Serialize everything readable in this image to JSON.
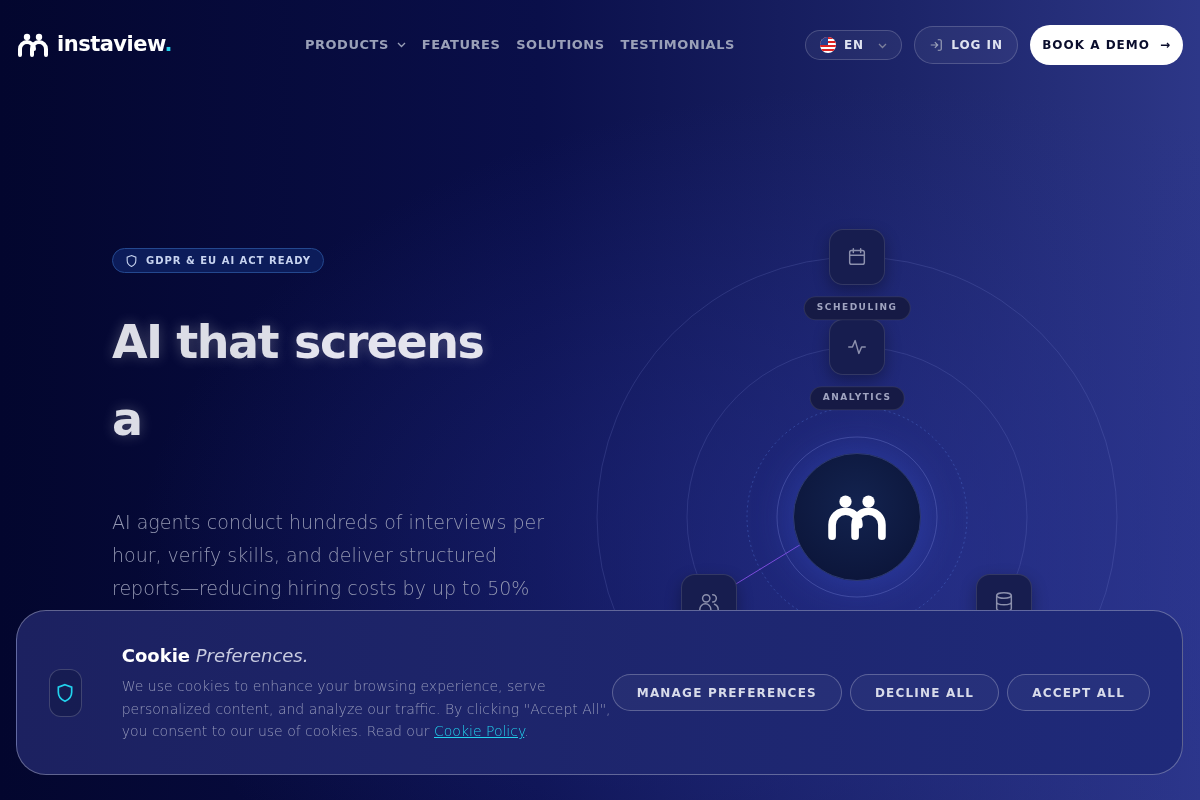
{
  "brand": {
    "name": "instaview",
    "dot": "."
  },
  "nav": [
    {
      "label": "PRODUCTS",
      "has_menu": true
    },
    {
      "label": "FEATURES",
      "has_menu": false
    },
    {
      "label": "SOLUTIONS",
      "has_menu": false
    },
    {
      "label": "TESTIMONIALS",
      "has_menu": false
    }
  ],
  "language": {
    "code": "EN"
  },
  "login": {
    "label": "LOG IN"
  },
  "demo": {
    "label": "BOOK A DEMO",
    "arrow": "→"
  },
  "hero": {
    "badge": "GDPR & EU AI ACT READY",
    "heading_static": "AI that",
    "heading_word": "screens",
    "heading_line_2": "a",
    "text": "AI agents conduct hundreds of interviews per hour, verify skills, and deliver structured reports—reducing hiring costs by up to 50%"
  },
  "diagram": {
    "labels": [
      "SCHEDULING",
      "ANALYTICS"
    ]
  },
  "cookie": {
    "title": "**Cookie** *Preferences.*",
    "text": "We use cookies to enhance your browsing experience, serve personalized content, and analyze our traffic. By clicking \"Accept All\", you consent to our use of cookies. Read our ",
    "link": "Cookie Policy",
    "text_end": ".",
    "buttons": [
      "MANAGE PREFERENCES",
      "DECLINE ALL",
      "ACCEPT ALL"
    ]
  }
}
